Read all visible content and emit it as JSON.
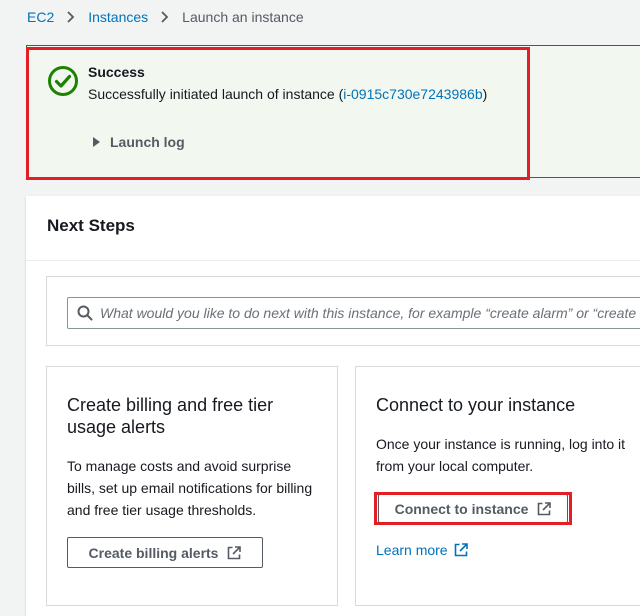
{
  "breadcrumb": {
    "items": [
      {
        "label": "EC2",
        "link": true
      },
      {
        "label": "Instances",
        "link": true
      },
      {
        "label": "Launch an instance",
        "link": false
      }
    ]
  },
  "flash": {
    "type": "success",
    "title": "Success",
    "message_prefix": "Successfully initiated launch of instance (",
    "instance_id": "i-0915c730e7243986b",
    "message_suffix": ")",
    "launch_log_label": "Launch log"
  },
  "next_steps": {
    "title": "Next Steps",
    "search_placeholder": "What would you like to do next with this instance, for example “create alarm” or “create backup”"
  },
  "cards": {
    "billing": {
      "title": "Create billing and free tier usage alerts",
      "body": "To manage costs and avoid surprise bills, set up email notifications for billing and free tier usage thresholds.",
      "button_label": "Create billing alerts"
    },
    "connect": {
      "title": "Connect to your instance",
      "body": "Once your instance is running, log into it from your local computer.",
      "button_label": "Connect to instance",
      "link_label": "Learn more"
    }
  },
  "icons": {
    "success": "check-circle-icon",
    "search": "search-icon",
    "external": "external-link-icon",
    "caret": "caret-right-icon",
    "separator": "chevron-right-icon"
  },
  "colors": {
    "success_green": "#1d8102",
    "link_blue": "#0073bb",
    "highlight_red": "#e31e24",
    "text_dark": "#16191f",
    "text_muted": "#545b64"
  }
}
